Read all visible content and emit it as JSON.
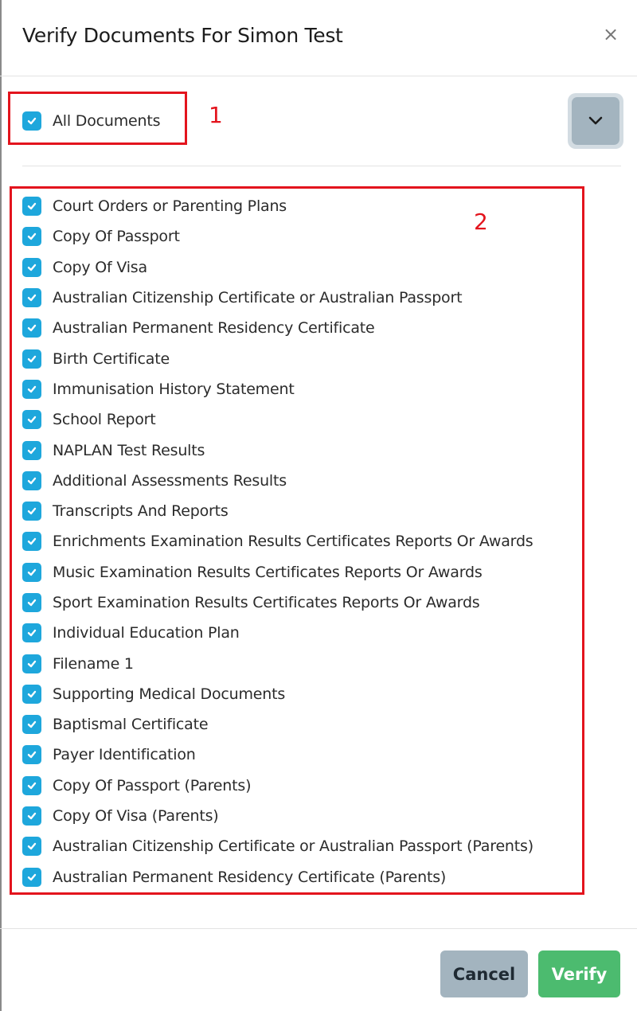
{
  "modal": {
    "title": "Verify Documents For Simon Test",
    "close_label": "×"
  },
  "all_documents": {
    "label": "All Documents",
    "checked": true
  },
  "annotations": {
    "box1_number": "1",
    "box2_number": "2"
  },
  "toggle": {
    "icon": "chevron-down-icon"
  },
  "documents": [
    {
      "label": "Court Orders or Parenting Plans",
      "checked": true
    },
    {
      "label": "Copy Of Passport",
      "checked": true
    },
    {
      "label": "Copy Of Visa",
      "checked": true
    },
    {
      "label": "Australian Citizenship Certificate or Australian Passport",
      "checked": true
    },
    {
      "label": "Australian Permanent Residency Certificate",
      "checked": true
    },
    {
      "label": "Birth Certificate",
      "checked": true
    },
    {
      "label": "Immunisation History Statement",
      "checked": true
    },
    {
      "label": "School Report",
      "checked": true
    },
    {
      "label": "NAPLAN Test Results",
      "checked": true
    },
    {
      "label": "Additional Assessments Results",
      "checked": true
    },
    {
      "label": "Transcripts And Reports",
      "checked": true
    },
    {
      "label": "Enrichments Examination Results Certificates Reports Or Awards",
      "checked": true
    },
    {
      "label": "Music Examination Results Certificates Reports Or Awards",
      "checked": true
    },
    {
      "label": "Sport Examination Results Certificates Reports Or Awards",
      "checked": true
    },
    {
      "label": "Individual Education Plan",
      "checked": true
    },
    {
      "label": "Filename 1",
      "checked": true
    },
    {
      "label": "Supporting Medical Documents",
      "checked": true
    },
    {
      "label": "Baptismal Certificate",
      "checked": true
    },
    {
      "label": "Payer Identification",
      "checked": true
    },
    {
      "label": "Copy Of Passport (Parents)",
      "checked": true
    },
    {
      "label": "Copy Of Visa (Parents)",
      "checked": true
    },
    {
      "label": "Australian Citizenship Certificate or Australian Passport (Parents)",
      "checked": true
    },
    {
      "label": "Australian Permanent Residency Certificate (Parents)",
      "checked": true
    }
  ],
  "footer": {
    "cancel_label": "Cancel",
    "verify_label": "Verify"
  },
  "colors": {
    "checkbox": "#1ea7dc",
    "verify": "#4cbb6f",
    "cancel": "#a3b4bf",
    "annotation": "#e3141d"
  }
}
